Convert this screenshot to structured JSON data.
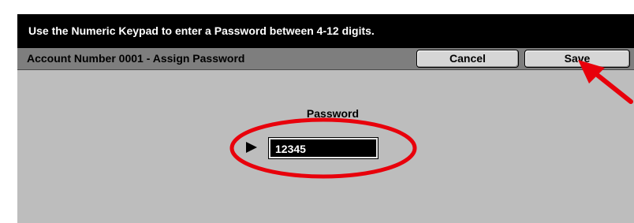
{
  "instruction": "Use the Numeric Keypad to enter a Password between 4-12 digits.",
  "title_bar": {
    "title": "Account Number 0001 - Assign Password",
    "cancel_label": "Cancel",
    "save_label": "Save"
  },
  "password": {
    "label": "Password",
    "value": "12345"
  },
  "colors": {
    "screen_background": "#bdbdbd",
    "instruction_bar": "#000000",
    "title_bar": "#7e7e7e",
    "annotation_red": "#e8000b"
  },
  "icons": {
    "field_pointer": "right-triangle-pointer-icon",
    "annotation_arrow": "red-arrow-annotation",
    "annotation_ellipse": "red-ellipse-annotation"
  }
}
